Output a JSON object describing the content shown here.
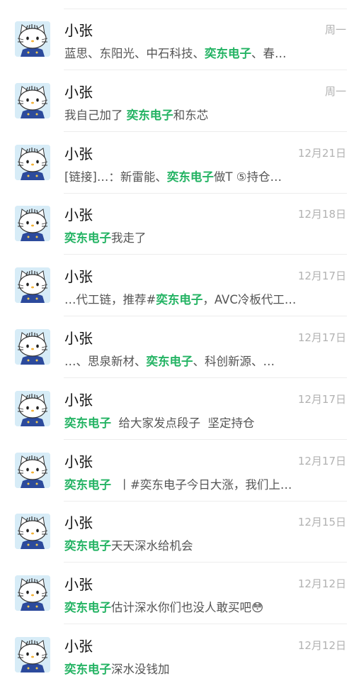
{
  "conversations": [
    {
      "name": "小张",
      "time": "周一",
      "snippet": [
        {
          "text": "蓝思、东阳光、中石科技、"
        },
        {
          "text": "奕东电子",
          "hl": true
        },
        {
          "text": "、春…"
        }
      ]
    },
    {
      "name": "小张",
      "time": "周一",
      "snippet": [
        {
          "text": "我自己加了 "
        },
        {
          "text": "奕东电子",
          "hl": true
        },
        {
          "text": "和东芯"
        }
      ]
    },
    {
      "name": "小张",
      "time": "12月21日",
      "snippet": [
        {
          "text": "[链接]…：新雷能、"
        },
        {
          "text": "奕东电子",
          "hl": true
        },
        {
          "text": "做T ⑤持仓…"
        }
      ]
    },
    {
      "name": "小张",
      "time": "12月18日",
      "snippet": [
        {
          "text": "奕东电子",
          "hl": true
        },
        {
          "text": "我走了"
        }
      ]
    },
    {
      "name": "小张",
      "time": "12月17日",
      "snippet": [
        {
          "text": "…代工链，推荐#"
        },
        {
          "text": "奕东电子",
          "hl": true
        },
        {
          "text": "，AVC冷板代工…"
        }
      ]
    },
    {
      "name": "小张",
      "time": "12月17日",
      "snippet": [
        {
          "text": "…、思泉新材、"
        },
        {
          "text": "奕东电子",
          "hl": true
        },
        {
          "text": "、科创新源、…"
        }
      ]
    },
    {
      "name": "小张",
      "time": "12月17日",
      "snippet": [
        {
          "text": "奕东电子",
          "hl": true
        },
        {
          "text": "  给大家发点段子  坚定持仓"
        }
      ]
    },
    {
      "name": "小张",
      "time": "12月17日",
      "snippet": [
        {
          "text": "奕东电子",
          "hl": true
        },
        {
          "text": "  丨#奕东电子今日大涨，我们上…"
        }
      ]
    },
    {
      "name": "小张",
      "time": "12月15日",
      "snippet": [
        {
          "text": "奕东电子",
          "hl": true
        },
        {
          "text": "天天深水给机会"
        }
      ]
    },
    {
      "name": "小张",
      "time": "12月12日",
      "snippet": [
        {
          "text": "奕东电子",
          "hl": true
        },
        {
          "text": "估计深水你们也没人敢买吧😳"
        }
      ]
    },
    {
      "name": "小张",
      "time": "12月12日",
      "snippet": [
        {
          "text": "奕东电子",
          "hl": true
        },
        {
          "text": "深水没钱加"
        }
      ]
    }
  ],
  "colors": {
    "highlight": "#23b363",
    "name": "#111111",
    "time": "#b2b2b2",
    "snippet": "#555555",
    "avatar_bg": "#d7ecf7",
    "divider": "#ededed"
  },
  "icons": {
    "avatar": "hello-kitty-avatar-icon"
  }
}
